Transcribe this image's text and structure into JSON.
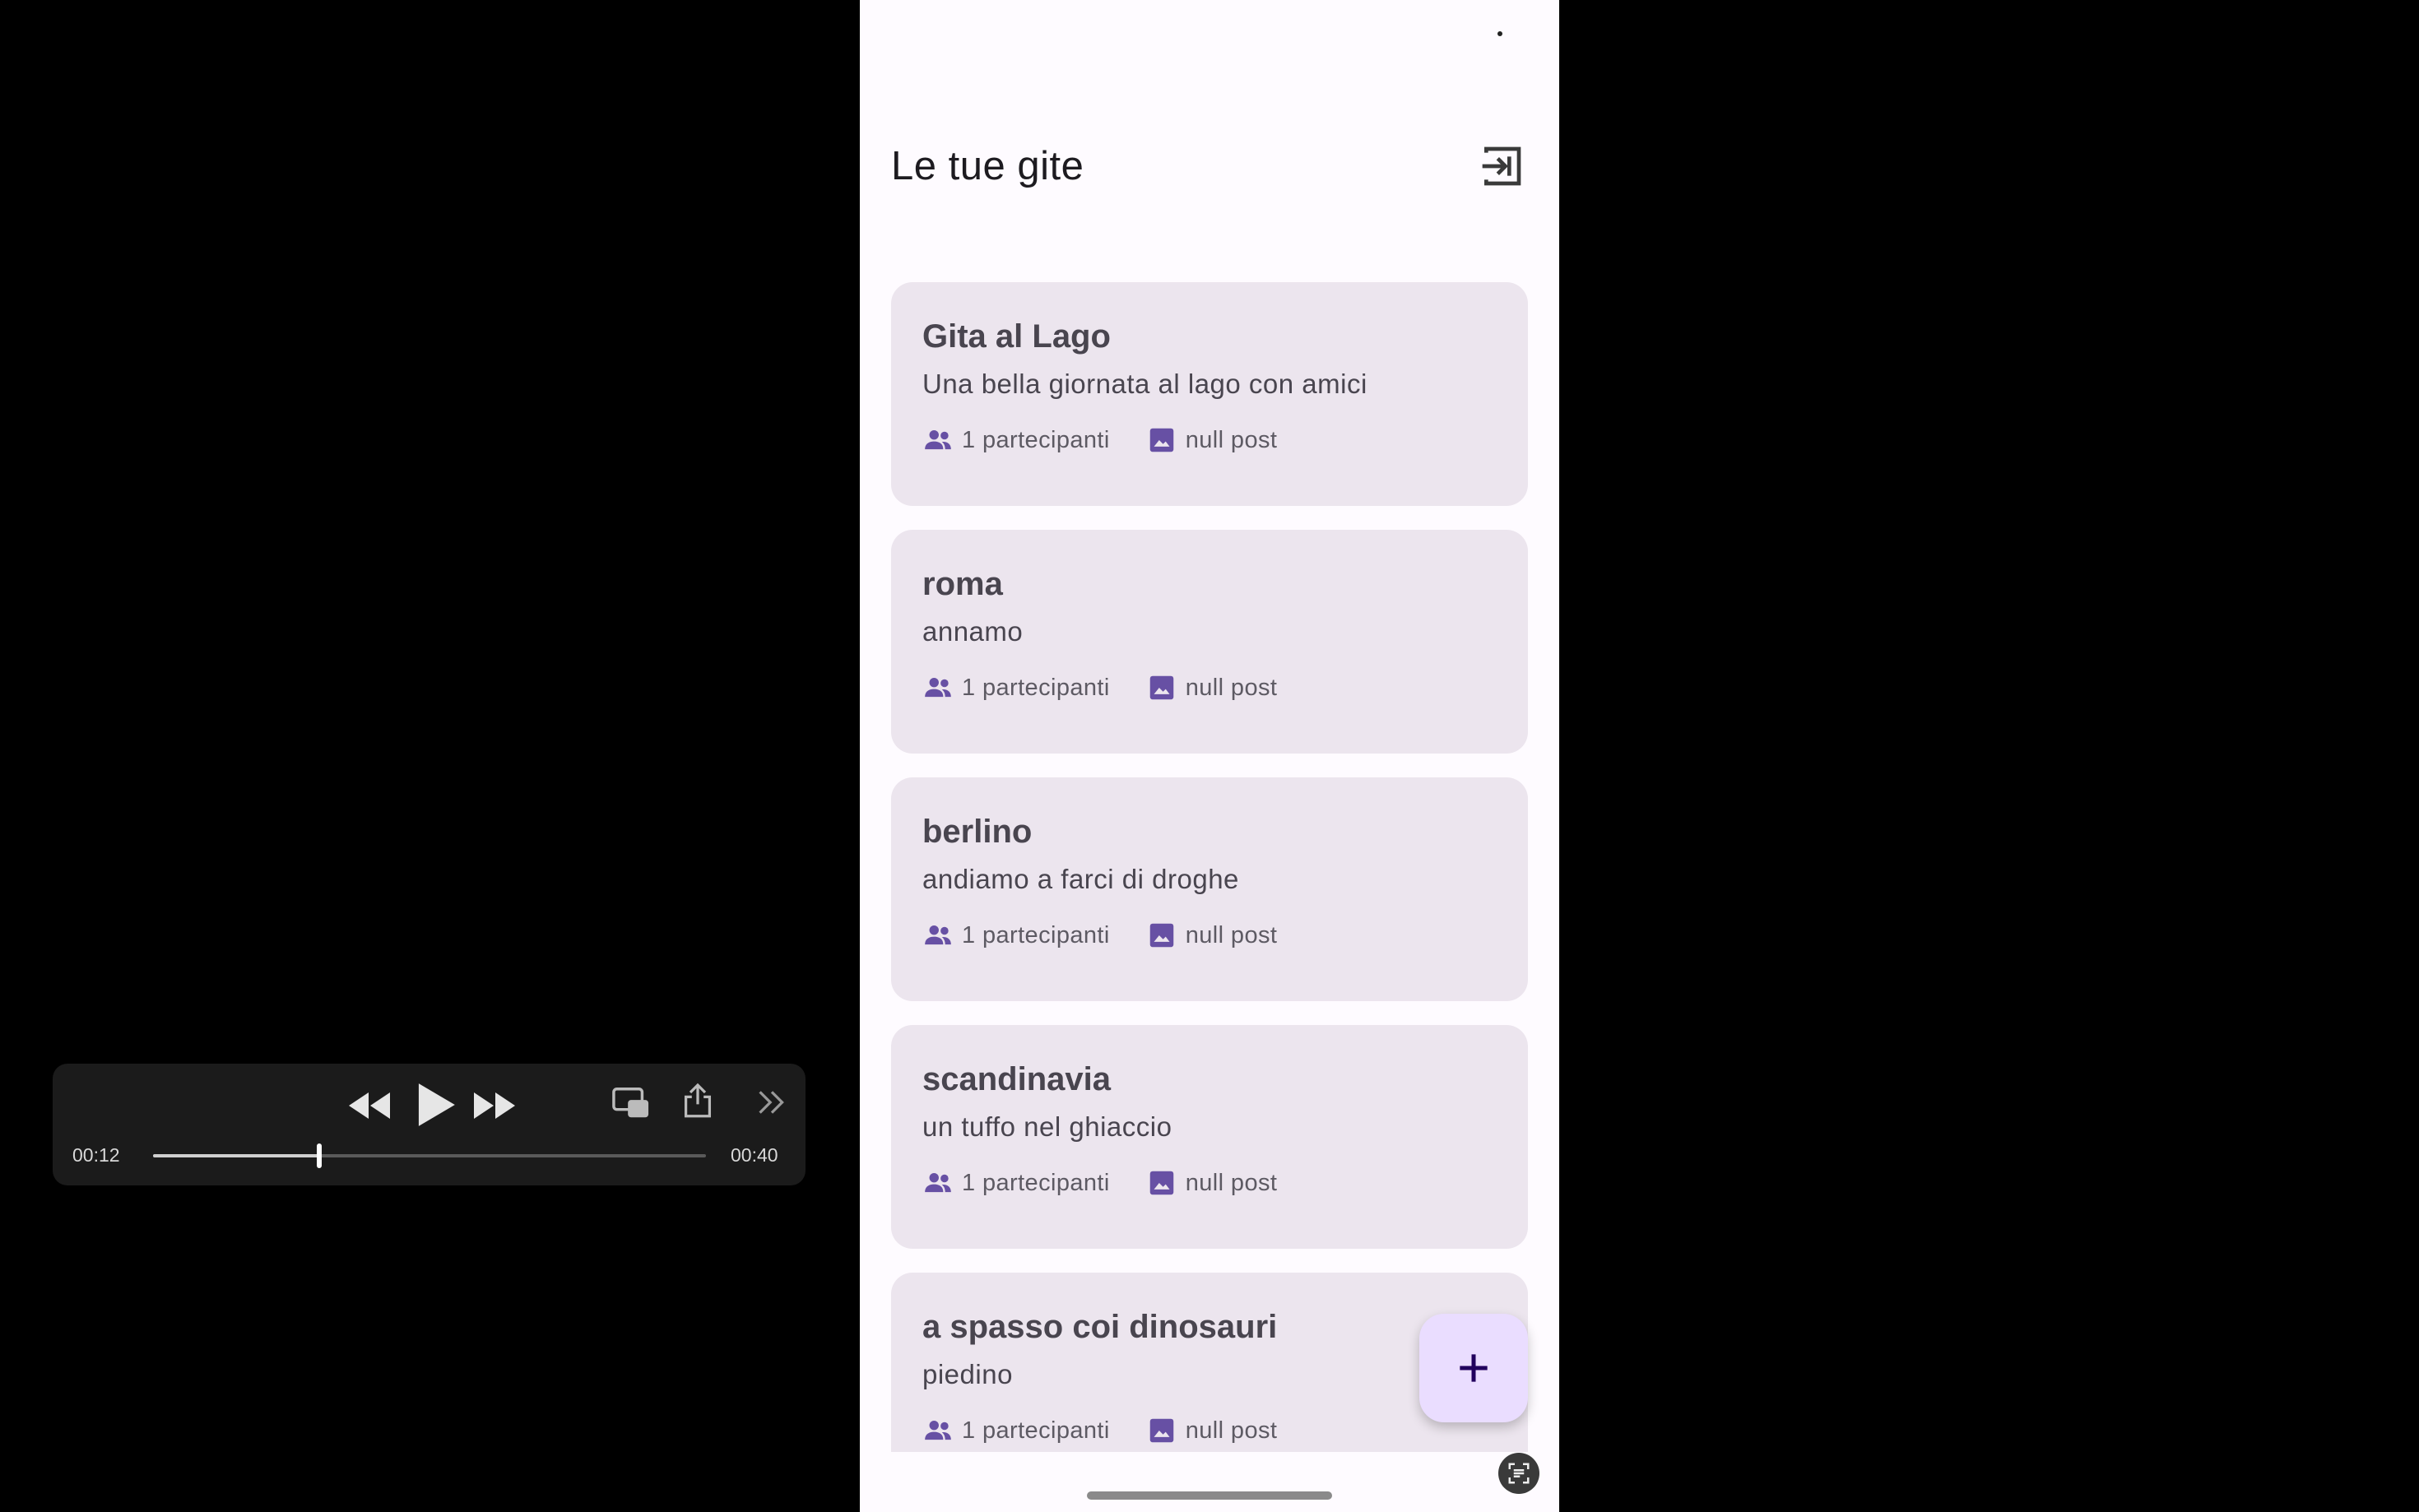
{
  "app": {
    "title": "Le tue gite",
    "logout_icon": "logout-icon",
    "accent_color": "#6750a4",
    "card_color": "#ece5ee"
  },
  "trips": [
    {
      "title": "Gita al Lago",
      "description": "Una bella giornata al lago con amici",
      "participants": "1 partecipanti",
      "posts": "null post"
    },
    {
      "title": "roma",
      "description": "annamo",
      "participants": "1 partecipanti",
      "posts": "null post"
    },
    {
      "title": "berlino",
      "description": "andiamo a farci di droghe",
      "participants": "1 partecipanti",
      "posts": "null post"
    },
    {
      "title": "scandinavia",
      "description": "un tuffo nel ghiaccio",
      "participants": "1 partecipanti",
      "posts": "null post"
    },
    {
      "title": "a spasso coi dinosauri",
      "description": "piedino",
      "participants": "1 partecipanti",
      "posts": "null post"
    }
  ],
  "fab": {
    "icon": "plus-icon"
  },
  "player": {
    "elapsed": "00:12",
    "duration": "00:40",
    "progress_fraction": 0.3,
    "icons": [
      "rewind-icon",
      "play-icon",
      "fast-forward-icon",
      "picture-in-picture-icon",
      "share-icon",
      "more-chevron-icon"
    ]
  }
}
